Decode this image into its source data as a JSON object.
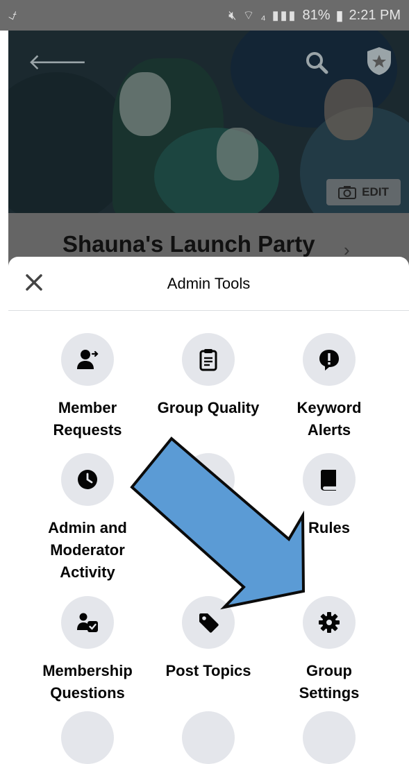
{
  "status_bar": {
    "left_icon": "download-check-icon",
    "battery": "81%",
    "time": "2:21 PM",
    "icons": [
      "mute-icon",
      "wifi-icon",
      "4g-icon",
      "signal-icon",
      "battery-icon"
    ]
  },
  "cover": {
    "edit_label": "EDIT"
  },
  "group": {
    "title": "Shauna's Launch Party",
    "chevron": "›"
  },
  "sheet": {
    "title": "Admin Tools",
    "tools": [
      {
        "label_line1": "Member",
        "label_line2": "Requests",
        "icon": "person-arrow-icon"
      },
      {
        "label_line1": "Group Quality",
        "label_line2": "",
        "icon": "clipboard-icon"
      },
      {
        "label_line1": "Keyword",
        "label_line2": "Alerts",
        "icon": "alert-bubble-icon"
      },
      {
        "label_line1": "Admin and",
        "label_line2": "Moderator",
        "label_line3": "Activity",
        "icon": "clock-icon"
      },
      {
        "label_line1": "",
        "label_line2": "",
        "icon": "person-icon"
      },
      {
        "label_line1": "Rules",
        "label_line2": "",
        "icon": "book-icon"
      },
      {
        "label_line1": "Membership",
        "label_line2": "Questions",
        "icon": "member-question-icon"
      },
      {
        "label_line1": "Post Topics",
        "label_line2": "",
        "icon": "tag-icon"
      },
      {
        "label_line1": "Group",
        "label_line2": "Settings",
        "icon": "gear-icon"
      }
    ]
  },
  "colors": {
    "arrow_fill": "#5b9bd5",
    "icon_bg": "#e4e6eb",
    "status_bg": "#6b6b6b"
  }
}
